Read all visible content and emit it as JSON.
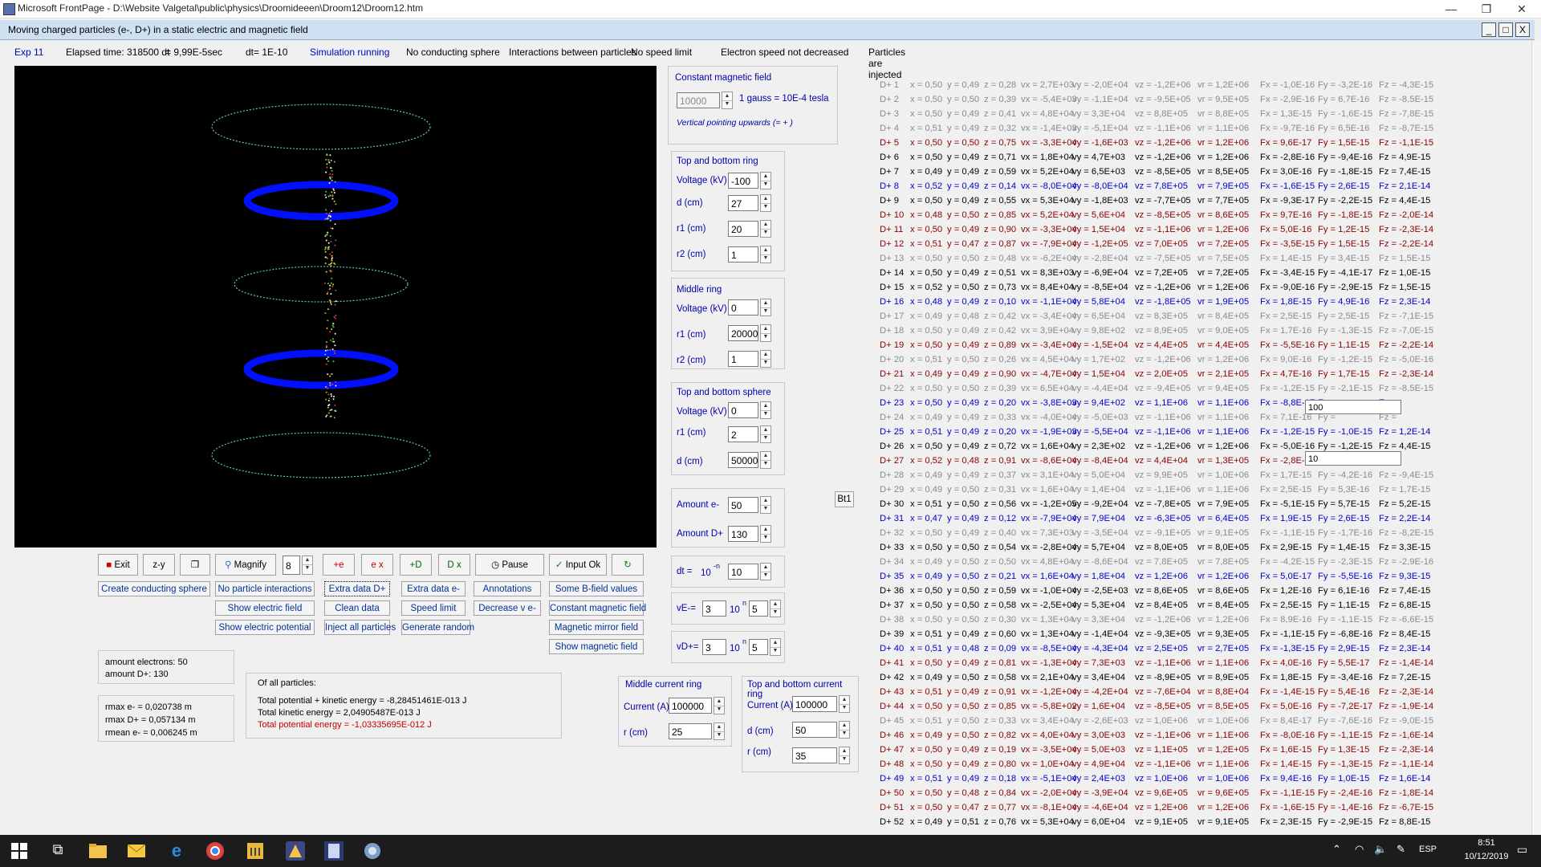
{
  "window": {
    "title": "Microsoft FrontPage - D:\\Website Valgetal\\public\\physics\\Droomideeen\\Droom12\\Droom12.htm",
    "child_title": "Moving charged particles (e-, D+) in a  static electric and magnetic field",
    "min": "—",
    "max": "❐",
    "close": "✕",
    "child_min": "_",
    "child_max": "□",
    "child_close": "X"
  },
  "status": {
    "exp": "Exp 11",
    "elapsed": "Elapsed time: 318500 dt",
    "elapsed_sec": "= 9,99E-5sec",
    "dt": "dt= 1E-10",
    "running": "Simulation running",
    "sphere": "No conducting sphere",
    "interactions": "Interactions between particles",
    "speed": "No speed limit",
    "electron": "Electron speed not decreased",
    "injected": "Particles are injected"
  },
  "magnetic": {
    "header": "Constant magnetic field",
    "value": "10000",
    "unit": "1 gauss = 10E-4 tesla",
    "note": "Vertical pointing upwards (= + )"
  },
  "top_bottom_ring": {
    "header": "Top and bottom ring",
    "voltage_label": "Voltage (kV)",
    "voltage": "-100",
    "d_label": "d (cm)",
    "d": "27",
    "r1_label": "r1 (cm)",
    "r1": "20",
    "r2_label": "r2 (cm)",
    "r2": "1"
  },
  "middle_ring": {
    "header": "Middle ring",
    "voltage_label": "Voltage (kV)",
    "voltage": "0",
    "r1_label": "r1 (cm)",
    "r1": "20000",
    "r2_label": "r2 (cm)",
    "r2": "1"
  },
  "sphere": {
    "header": "Top and bottom sphere",
    "voltage_label": "Voltage (kV)",
    "voltage": "0",
    "r1_label": "r1 (cm)",
    "r1": "2",
    "d_label": "d (cm)",
    "d": "50000"
  },
  "amounts": {
    "e_label": "Amount e-",
    "e": "50",
    "d_label": "Amount D+",
    "d": "130"
  },
  "dt_box": {
    "label": "dt =",
    "base": "10",
    "exp": "-n",
    "n": "10"
  },
  "ve_box": {
    "label": "vE-=",
    "mant": "3",
    "base": "10",
    "exp": "n",
    "n": "5"
  },
  "vd_box": {
    "label": "vD+=",
    "mant": "3",
    "base": "10",
    "exp": "n",
    "n": "5"
  },
  "bt1": "Bt1",
  "toolbar": {
    "exit": "Exit",
    "zy": "z-y",
    "magnify": "Magnify",
    "magnify_value": "8",
    "e_up": "+e",
    "e_x": "e x",
    "d_up": "+D",
    "d_x": "D x",
    "pause": "Pause",
    "input_ok": "Input Ok"
  },
  "buttons": {
    "create_sphere": "Create conducting sphere",
    "no_interactions": "No particle interactions",
    "extra_d": "Extra data D+",
    "extra_e": "Extra data e-",
    "annotations": "Annotations",
    "some_b": "Some B-field values",
    "show_electric_field": "Show electric field",
    "clean_data": "Clean data",
    "speed_limit": "Speed limit",
    "decrease_ve": "Decrease v e-",
    "constant_mag": "Constant magnetic field",
    "show_potential": "Show electric potential",
    "inject_all": "Inject all particles",
    "generate_random": "Generate random",
    "mirror_field": "Magnetic mirror field",
    "show_magnetic": "Show magnetic field"
  },
  "counts": {
    "electrons": "amount electrons: 50",
    "d": "amount D+: 130"
  },
  "rmax": {
    "e": "rmax e-  = 0,020738 m",
    "d": "rmax D+  = 0,057134 m",
    "mean": "rmean e-  = 0,006245 m"
  },
  "energy": {
    "header": "Of all particles:",
    "total": "Total potential + kinetic energy = -8,28451461E-013 J",
    "kinetic": "Total kinetic energy = 2,04905487E-013 J",
    "potential": "Total potential energy = -1,03335695E-012 J"
  },
  "middle_current": {
    "header": "Middle current ring",
    "current_label": "Current (A)",
    "current": "100000",
    "r_label": "r  (cm)",
    "r": "25"
  },
  "top_current": {
    "header": "Top and bottom current ring",
    "current_label": "Current (A)",
    "current": "100000",
    "d_label": "d (cm)",
    "d": "50",
    "r_label": "r (cm)",
    "r": "35"
  },
  "overlay": {
    "input1": "100",
    "input2": "10"
  },
  "particles": [
    [
      "D+ 1",
      "x = 0,50",
      "y = 0,49",
      "z = 0,28",
      "vx = 2,7E+03",
      "vy = -2,0E+04",
      "vz = -1,2E+06",
      "vr = 1,2E+06",
      "Fx = -1,0E-16",
      "Fy = -3,2E-16",
      "Fz = -4,3E-15"
    ],
    [
      "D+ 2",
      "x = 0,50",
      "y = 0,50",
      "z = 0,39",
      "vx = -5,4E+03",
      "vy = -1,1E+04",
      "vz = -9,5E+05",
      "vr = 9,5E+05",
      "Fx = -2,9E-16",
      "Fy = 6,7E-16",
      "Fz = -8,5E-15"
    ],
    [
      "D+ 3",
      "x = 0,50",
      "y = 0,49",
      "z = 0,41",
      "vx = 4,8E+04",
      "vy = 3,3E+04",
      "vz = 8,8E+05",
      "vr = 8,8E+05",
      "Fx = 1,3E-15",
      "Fy = -1,6E-15",
      "Fz = -7,8E-15"
    ],
    [
      "D+ 4",
      "x = 0,51",
      "y = 0,49",
      "z = 0,32",
      "vx = -1,4E+03",
      "vy = -5,1E+04",
      "vz = -1,1E+06",
      "vr = 1,1E+06",
      "Fx = -9,7E-16",
      "Fy = 6,5E-16",
      "Fz = -8,7E-15"
    ],
    [
      "D+ 5",
      "x = 0,50",
      "y = 0,50",
      "z = 0,75",
      "vx = -3,3E+04",
      "vy = -1,6E+03",
      "vz = -1,2E+06",
      "vr = 1,2E+06",
      "Fx = 9,6E-17",
      "Fy = 1,5E-15",
      "Fz = -1,1E-15"
    ],
    [
      "D+ 6",
      "x = 0,50",
      "y = 0,49",
      "z = 0,71",
      "vx = 1,8E+04",
      "vy = 4,7E+03",
      "vz = -1,2E+06",
      "vr = 1,2E+06",
      "Fx = -2,8E-16",
      "Fy = -9,4E-16",
      "Fz = 4,9E-15"
    ],
    [
      "D+ 7",
      "x = 0,49",
      "y = 0,49",
      "z = 0,59",
      "vx = 5,2E+04",
      "vy = 6,5E+03",
      "vz = -8,5E+05",
      "vr = 8,5E+05",
      "Fx = 3,0E-16",
      "Fy = -1,8E-15",
      "Fz = 7,4E-15"
    ],
    [
      "D+ 8",
      "x = 0,52",
      "y = 0,49",
      "z = 0,14",
      "vx = -8,0E+04",
      "vy = -8,0E+04",
      "vz = 7,8E+05",
      "vr = 7,9E+05",
      "Fx = -1,6E-15",
      "Fy = 2,6E-15",
      "Fz = 2,1E-14"
    ],
    [
      "D+ 9",
      "x = 0,50",
      "y = 0,49",
      "z = 0,55",
      "vx = 5,3E+04",
      "vy = -1,8E+03",
      "vz = -7,7E+05",
      "vr = 7,7E+05",
      "Fx = -9,3E-17",
      "Fy = -2,2E-15",
      "Fz = 4,4E-15"
    ],
    [
      "D+ 10",
      "x = 0,48",
      "y = 0,50",
      "z = 0,85",
      "vx = 5,2E+04",
      "vy = 5,6E+04",
      "vz = -8,5E+05",
      "vr = 8,6E+05",
      "Fx = 9,7E-16",
      "Fy = -1,8E-15",
      "Fz = -2,0E-14"
    ],
    [
      "D+ 11",
      "x = 0,50",
      "y = 0,49",
      "z = 0,90",
      "vx = -3,3E+04",
      "vy = 1,5E+04",
      "vz = -1,1E+06",
      "vr = 1,2E+06",
      "Fx = 5,0E-16",
      "Fy = 1,2E-15",
      "Fz = -2,3E-14"
    ],
    [
      "D+ 12",
      "x = 0,51",
      "y = 0,47",
      "z = 0,87",
      "vx = -7,9E+04",
      "vy = -1,2E+05",
      "vz = 7,0E+05",
      "vr = 7,2E+05",
      "Fx = -3,5E-15",
      "Fy = 1,5E-15",
      "Fz = -2,2E-14"
    ],
    [
      "D+ 13",
      "x = 0,50",
      "y = 0,50",
      "z = 0,48",
      "vx = -6,2E+04",
      "vy = -2,8E+04",
      "vz = -7,5E+05",
      "vr = 7,5E+05",
      "Fx = 1,4E-15",
      "Fy = 3,4E-15",
      "Fz = 1,5E-15"
    ],
    [
      "D+ 14",
      "x = 0,50",
      "y = 0,49",
      "z = 0,51",
      "vx = 8,3E+03",
      "vy = -6,9E+04",
      "vz = 7,2E+05",
      "vr = 7,2E+05",
      "Fx = -3,4E-15",
      "Fy = -4,1E-17",
      "Fz = 1,0E-15"
    ],
    [
      "D+ 15",
      "x = 0,52",
      "y = 0,50",
      "z = 0,73",
      "vx = 8,4E+04",
      "vy = -8,5E+04",
      "vz = -1,2E+06",
      "vr = 1,2E+06",
      "Fx = -9,0E-16",
      "Fy = -2,9E-15",
      "Fz = 1,5E-15"
    ],
    [
      "D+ 16",
      "x = 0,48",
      "y = 0,49",
      "z = 0,10",
      "vx = -1,1E+04",
      "vy = 5,8E+04",
      "vz = -1,8E+05",
      "vr = 1,9E+05",
      "Fx = 1,8E-15",
      "Fy = 4,9E-16",
      "Fz = 2,3E-14"
    ],
    [
      "D+ 17",
      "x = 0,49",
      "y = 0,48",
      "z = 0,42",
      "vx = -3,4E+04",
      "vy = 6,5E+04",
      "vz = 8,3E+05",
      "vr = 8,4E+05",
      "Fx = 2,5E-15",
      "Fy = 2,5E-15",
      "Fz = -7,1E-15"
    ],
    [
      "D+ 18",
      "x = 0,50",
      "y = 0,49",
      "z = 0,42",
      "vx = 3,9E+04",
      "vy = 9,8E+02",
      "vz = 8,9E+05",
      "vr = 9,0E+05",
      "Fx = 1,7E-16",
      "Fy = -1,3E-15",
      "Fz = -7,0E-15"
    ],
    [
      "D+ 19",
      "x = 0,50",
      "y = 0,49",
      "z = 0,89",
      "vx = -3,4E+04",
      "vy = -1,5E+04",
      "vz = 4,4E+05",
      "vr = 4,4E+05",
      "Fx = -5,5E-16",
      "Fy = 1,1E-15",
      "Fz = -2,2E-14"
    ],
    [
      "D+ 20",
      "x = 0,51",
      "y = 0,50",
      "z = 0,26",
      "vx = 4,5E+04",
      "vy = 1,7E+02",
      "vz = -1,2E+06",
      "vr = 1,2E+06",
      "Fx = 9,0E-16",
      "Fy = -1,2E-15",
      "Fz = -5,0E-16"
    ],
    [
      "D+ 21",
      "x = 0,49",
      "y = 0,49",
      "z = 0,90",
      "vx = -4,7E+04",
      "vy = 1,5E+04",
      "vz = 2,0E+05",
      "vr = 2,1E+05",
      "Fx = 4,7E-16",
      "Fy = 1,7E-15",
      "Fz = -2,3E-14"
    ],
    [
      "D+ 22",
      "x = 0,50",
      "y = 0,50",
      "z = 0,39",
      "vx = 6,5E+04",
      "vy = -4,4E+04",
      "vz = -9,4E+05",
      "vr = 9,4E+05",
      "Fx = -1,2E-15",
      "Fy = -2,1E-15",
      "Fz = -8,5E-15"
    ],
    [
      "D+ 23",
      "x = 0,50",
      "y = 0,49",
      "z = 0,20",
      "vx = -3,8E+03",
      "vy = 9,4E+02",
      "vz = 1,1E+06",
      "vr = 1,1E+06",
      "Fx = -8,8E-17",
      "Fy = ",
      "Fz = "
    ],
    [
      "D+ 24",
      "x = 0,49",
      "y = 0,49",
      "z = 0,33",
      "vx = -4,0E+04",
      "vy = -5,0E+03",
      "vz = -1,1E+06",
      "vr = 1,1E+06",
      "Fx = 7,1E-16",
      "Fy = ",
      "Fz = "
    ],
    [
      "D+ 25",
      "x = 0,51",
      "y = 0,49",
      "z = 0,20",
      "vx = -1,9E+03",
      "vy = -5,5E+04",
      "vz = -1,1E+06",
      "vr = 1,1E+06",
      "Fx = -1,2E-15",
      "Fy = -1,0E-15",
      "Fz = 1,2E-14"
    ],
    [
      "D+ 26",
      "x = 0,50",
      "y = 0,49",
      "z = 0,72",
      "vx = 1,6E+04",
      "vy = 2,3E+02",
      "vz = -1,2E+06",
      "vr = 1,2E+06",
      "Fx = -5,0E-16",
      "Fy = -1,2E-15",
      "Fz = 4,4E-15"
    ],
    [
      "D+ 27",
      "x = 0,52",
      "y = 0,48",
      "z = 0,91",
      "vx = -8,6E+04",
      "vy = -8,4E+04",
      "vz = 4,4E+04",
      "vr = 1,3E+05",
      "Fx = -2,8E-15",
      "Fy = ",
      "Fz = "
    ],
    [
      "D+ 28",
      "x = 0,49",
      "y = 0,49",
      "z = 0,37",
      "vx = 3,1E+04",
      "vy = 5,0E+04",
      "vz = 9,9E+05",
      "vr = 1,0E+06",
      "Fx = 1,7E-15",
      "Fy = -4,2E-16",
      "Fz = -9,4E-15"
    ],
    [
      "D+ 29",
      "x = 0,49",
      "y = 0,50",
      "z = 0,31",
      "vx = 1,6E+04",
      "vy = 1,4E+04",
      "vz = -1,1E+06",
      "vr = 1,1E+06",
      "Fx = 2,5E-15",
      "Fy = 5,3E-16",
      "Fz = 1,7E-15"
    ],
    [
      "D+ 30",
      "x = 0,51",
      "y = 0,50",
      "z = 0,56",
      "vx = -1,2E+05",
      "vy = -9,2E+04",
      "vz = -7,8E+05",
      "vr = 7,9E+05",
      "Fx = -5,1E-15",
      "Fy = 5,7E-15",
      "Fz = 5,2E-15"
    ],
    [
      "D+ 31",
      "x = 0,47",
      "y = 0,49",
      "z = 0,12",
      "vx = -7,9E+04",
      "vy = 7,9E+04",
      "vz = -6,3E+05",
      "vr = 6,4E+05",
      "Fx = 1,9E-15",
      "Fy = 2,6E-15",
      "Fz = 2,2E-14"
    ],
    [
      "D+ 32",
      "x = 0,50",
      "y = 0,49",
      "z = 0,40",
      "vx = 7,3E+03",
      "vy = -3,5E+04",
      "vz = -9,1E+05",
      "vr = 9,1E+05",
      "Fx = -1,1E-15",
      "Fy = -1,7E-16",
      "Fz = -8,2E-15"
    ],
    [
      "D+ 33",
      "x = 0,50",
      "y = 0,50",
      "z = 0,54",
      "vx = -2,8E+04",
      "vy = 5,7E+04",
      "vz = 8,0E+05",
      "vr = 8,0E+05",
      "Fx = 2,9E-15",
      "Fy = 1,4E-15",
      "Fz = 3,3E-15"
    ],
    [
      "D+ 34",
      "x = 0,49",
      "y = 0,50",
      "z = 0,50",
      "vx = 4,8E+04",
      "vy = -8,6E+04",
      "vz = 7,8E+05",
      "vr = 7,8E+05",
      "Fx = -4,2E-15",
      "Fy = -2,3E-15",
      "Fz = -2,9E-16"
    ],
    [
      "D+ 35",
      "x = 0,49",
      "y = 0,50",
      "z = 0,21",
      "vx = 1,6E+04",
      "vy = 1,8E+04",
      "vz = 1,2E+06",
      "vr = 1,2E+06",
      "Fx = 5,0E-17",
      "Fy = -5,5E-16",
      "Fz = 9,3E-15"
    ],
    [
      "D+ 36",
      "x = 0,50",
      "y = 0,50",
      "z = 0,59",
      "vx = -1,0E+04",
      "vy = -2,5E+03",
      "vz = 8,6E+05",
      "vr = 8,6E+05",
      "Fx = 1,2E-16",
      "Fy = 6,1E-16",
      "Fz = 7,4E-15"
    ],
    [
      "D+ 37",
      "x = 0,50",
      "y = 0,50",
      "z = 0,58",
      "vx = -2,5E+04",
      "vy = 5,3E+04",
      "vz = 8,4E+05",
      "vr = 8,4E+05",
      "Fx = 2,5E-15",
      "Fy = 1,1E-15",
      "Fz = 6,8E-15"
    ],
    [
      "D+ 38",
      "x = 0,50",
      "y = 0,50",
      "z = 0,30",
      "vx = 1,3E+04",
      "vy = 3,3E+04",
      "vz = -1,2E+06",
      "vr = 1,2E+06",
      "Fx = 8,9E-16",
      "Fy = -1,1E-15",
      "Fz = -6,6E-15"
    ],
    [
      "D+ 39",
      "x = 0,51",
      "y = 0,49",
      "z = 0,60",
      "vx = 1,3E+04",
      "vy = -1,4E+04",
      "vz = -9,3E+05",
      "vr = 9,3E+05",
      "Fx = -1,1E-15",
      "Fy = -6,8E-16",
      "Fz = 8,4E-15"
    ],
    [
      "D+ 40",
      "x = 0,51",
      "y = 0,48",
      "z = 0,09",
      "vx = -8,5E+04",
      "vy = -4,3E+04",
      "vz = 2,5E+05",
      "vr = 2,7E+05",
      "Fx = -1,3E-15",
      "Fy = 2,9E-15",
      "Fz = 2,3E-14"
    ],
    [
      "D+ 41",
      "x = 0,50",
      "y = 0,49",
      "z = 0,81",
      "vx = -1,3E+04",
      "vy = 7,3E+03",
      "vz = -1,1E+06",
      "vr = 1,1E+06",
      "Fx = 4,0E-16",
      "Fy = 5,5E-17",
      "Fz = -1,4E-14"
    ],
    [
      "D+ 42",
      "x = 0,49",
      "y = 0,50",
      "z = 0,58",
      "vx = 2,1E+04",
      "vy = 3,4E+04",
      "vz = -8,9E+05",
      "vr = 8,9E+05",
      "Fx = 1,8E-15",
      "Fy = -3,4E-16",
      "Fz = 7,2E-15"
    ],
    [
      "D+ 43",
      "x = 0,51",
      "y = 0,49",
      "z = 0,91",
      "vx = -1,2E+04",
      "vy = -4,2E+04",
      "vz = -7,6E+04",
      "vr = 8,8E+04",
      "Fx = -1,4E-15",
      "Fy = 5,4E-16",
      "Fz = -2,3E-14"
    ],
    [
      "D+ 44",
      "x = 0,50",
      "y = 0,50",
      "z = 0,85",
      "vx = -5,8E+02",
      "vy = 1,6E+04",
      "vz = -8,5E+05",
      "vr = 8,5E+05",
      "Fx = 5,0E-16",
      "Fy = -7,2E-17",
      "Fz = -1,9E-14"
    ],
    [
      "D+ 45",
      "x = 0,51",
      "y = 0,50",
      "z = 0,33",
      "vx = 3,4E+04",
      "vy = -2,6E+03",
      "vz = 1,0E+06",
      "vr = 1,0E+06",
      "Fx = 8,4E-17",
      "Fy = -7,6E-16",
      "Fz = -9,0E-15"
    ],
    [
      "D+ 46",
      "x = 0,49",
      "y = 0,50",
      "z = 0,82",
      "vx = 4,0E+04",
      "vy = 3,0E+03",
      "vz = -1,1E+06",
      "vr = 1,1E+06",
      "Fx = -8,0E-16",
      "Fy = -1,1E-15",
      "Fz = -1,6E-14"
    ],
    [
      "D+ 47",
      "x = 0,50",
      "y = 0,49",
      "z = 0,19",
      "vx = -3,5E+04",
      "vy = 5,0E+03",
      "vz = 1,1E+05",
      "vr = 1,2E+05",
      "Fx = 1,6E-15",
      "Fy = 1,3E-15",
      "Fz = -2,3E-14"
    ],
    [
      "D+ 48",
      "x = 0,50",
      "y = 0,49",
      "z = 0,80",
      "vx = 1,0E+04",
      "vy = 4,9E+04",
      "vz = -1,1E+06",
      "vr = 1,1E+06",
      "Fx = 1,4E-15",
      "Fy = -1,3E-15",
      "Fz = -1,1E-14"
    ],
    [
      "D+ 49",
      "x = 0,51",
      "y = 0,49",
      "z = 0,18",
      "vx = -5,1E+04",
      "vy = 2,4E+03",
      "vz = 1,0E+06",
      "vr = 1,0E+06",
      "Fx = 9,4E-16",
      "Fy = 1,0E-15",
      "Fz = 1,6E-14"
    ],
    [
      "D+ 50",
      "x = 0,50",
      "y = 0,48",
      "z = 0,84",
      "vx = -2,0E+04",
      "vy = -3,9E+04",
      "vz = 9,6E+05",
      "vr = 9,6E+05",
      "Fx = -1,1E-15",
      "Fy = -2,4E-16",
      "Fz = -1,8E-14"
    ],
    [
      "D+ 51",
      "x = 0,50",
      "y = 0,47",
      "z = 0,77",
      "vx = -8,1E+04",
      "vy = -4,6E+04",
      "vz = 1,2E+06",
      "vr = 1,2E+06",
      "Fx = -1,6E-15",
      "Fy = -1,4E-16",
      "Fz = -6,7E-15"
    ],
    [
      "D+ 52",
      "x = 0,49",
      "y = 0,51",
      "z = 0,76",
      "vx = 5,3E+04",
      "vy = 6,0E+04",
      "vz = 9,1E+05",
      "vr = 9,1E+05",
      "Fx = 2,3E-15",
      "Fy = -2,9E-15",
      "Fz = 8,8E-15"
    ]
  ],
  "particle_colors": [
    "#8a8a8a",
    "#8a8a8a",
    "#8a8a8a",
    "#8a8a8a",
    "#8b0000",
    "#000000",
    "#000000",
    "#0000cc",
    "#000000",
    "#8b0000",
    "#8b0000",
    "#8b0000",
    "#8a8a8a",
    "#000000",
    "#000000",
    "#0000cc",
    "#8a8a8a",
    "#8a8a8a",
    "#8b0000",
    "#8a8a8a",
    "#8b0000",
    "#8a8a8a",
    "#0000cc",
    "#8a8a8a",
    "#0000cc",
    "#000000",
    "#8b0000",
    "#8a8a8a",
    "#8a8a8a",
    "#000000",
    "#0000cc",
    "#8a8a8a",
    "#000000",
    "#8a8a8a",
    "#0000cc",
    "#000000",
    "#000000",
    "#8a8a8a",
    "#000000",
    "#0000cc",
    "#8b0000",
    "#000000",
    "#8b0000",
    "#8b0000",
    "#8a8a8a",
    "#8b0000",
    "#8b0000",
    "#8b0000",
    "#0000cc",
    "#8b0000",
    "#8b0000",
    "#000000"
  ],
  "taskbar": {
    "lang": "ESP",
    "time": "8:51",
    "date": "10/12/2019"
  }
}
